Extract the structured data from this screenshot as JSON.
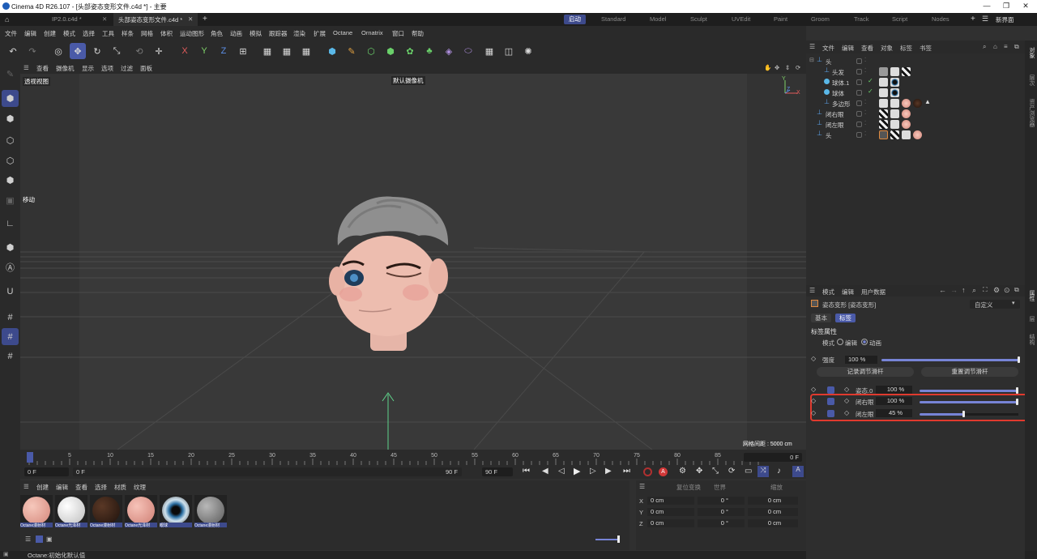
{
  "window": {
    "title": "Cinema 4D R26.107 - [头部姿态变形文件.c4d *] - 主要"
  },
  "file_tabs": [
    "IP2.0.c4d *",
    "头部姿态变形文件.c4d *"
  ],
  "layout_tabs": [
    "启动",
    "Standard",
    "Model",
    "Sculpt",
    "UVEdit",
    "Paint",
    "Groom",
    "Track",
    "Script",
    "Nodes"
  ],
  "new_layout": "新界面",
  "menu": [
    "文件",
    "编辑",
    "创建",
    "模式",
    "选择",
    "工具",
    "样条",
    "网格",
    "体积",
    "运动图形",
    "角色",
    "动画",
    "模拟",
    "跟踪器",
    "渲染",
    "扩展",
    "Octane",
    "Ornatrix",
    "窗口",
    "帮助"
  ],
  "toolbar_axes": [
    "X",
    "Y",
    "Z"
  ],
  "viewport": {
    "menu": [
      "查看",
      "摄像机",
      "显示",
      "选项",
      "过滤",
      "面板"
    ],
    "view_label": "透视视图",
    "camera_label": "默认摄像机",
    "move_label": "移动",
    "grid_spacing": "网格间距 : 5000 cm",
    "axis_y": "Y",
    "axis_x": "X",
    "axis_z": "Z"
  },
  "timeline": {
    "ticks": [
      "0",
      "5",
      "10",
      "15",
      "20",
      "25",
      "30",
      "35",
      "40",
      "45",
      "50",
      "55",
      "60",
      "65",
      "70",
      "75",
      "80",
      "85",
      "90"
    ],
    "current_frame": "0 F",
    "start_field": "0 F",
    "range_start": "0 F",
    "range_end": "90 F",
    "end_field": "90 F",
    "right_field": "0 F"
  },
  "material_manager": {
    "menu": [
      "创建",
      "编辑",
      "查看",
      "选择",
      "材质",
      "纹理"
    ],
    "materials": [
      {
        "label": "Octane漫射材",
        "color": "#e8a89c"
      },
      {
        "label": "Octane光泽材",
        "color": "#f0f0f0"
      },
      {
        "label": "Octane漫射材",
        "color": "#3a2418"
      },
      {
        "label": "Octane光泽材",
        "color": "#e9a29a"
      },
      {
        "label": "眼球",
        "color": "#1d5e8a"
      },
      {
        "label": "Octane漫射材",
        "color": "#8a8a8a"
      }
    ]
  },
  "coordinates": {
    "header": [
      "复位变换",
      "世界",
      "缩放"
    ],
    "rows": [
      {
        "axis": "X",
        "p": "0 cm",
        "r": "0 °",
        "s": "0 cm"
      },
      {
        "axis": "Y",
        "p": "0 cm",
        "r": "0 °",
        "s": "0 cm"
      },
      {
        "axis": "Z",
        "p": "0 cm",
        "r": "0 °",
        "s": "0 cm"
      }
    ]
  },
  "status": "Octane:初始化默认值",
  "object_manager": {
    "menu": [
      "文件",
      "编辑",
      "查看",
      "对象",
      "标签",
      "书签"
    ],
    "objects": [
      {
        "name": "头"
      },
      {
        "name": "头发"
      },
      {
        "name": "球体.1"
      },
      {
        "name": "球体"
      },
      {
        "name": "多边形"
      },
      {
        "name": "闭右眼"
      },
      {
        "name": "闭左眼"
      },
      {
        "name": "头"
      }
    ]
  },
  "attribute_manager": {
    "menu": [
      "模式",
      "编辑",
      "用户数据"
    ],
    "object_title": "姿态变形 [姿态变形]",
    "preset": "自定义",
    "tabs": [
      "基本",
      "标签"
    ],
    "section": "标签属性",
    "mode_label": "模式",
    "mode_options": [
      "编辑",
      "动画"
    ],
    "strength_label": "强度",
    "strength_value": "100 %",
    "strength_fraction": 1.0,
    "record_button": "记录调节滑杆",
    "reset_button": "重置调节滑杆",
    "poses": [
      {
        "name": "姿态.0",
        "value": "100 %",
        "fraction": 1.0
      },
      {
        "name": "闭右眼",
        "value": "100 %",
        "fraction": 1.0
      },
      {
        "name": "闭左眼",
        "value": "45 %",
        "fraction": 0.45
      }
    ],
    "highlight_color": "#e03a2e"
  },
  "right_strip": [
    "对象",
    "层次",
    "资产浏览器",
    "属性",
    "层",
    "结构"
  ],
  "colors": {
    "accent": "#3d4a8c",
    "slider": "#7784d6"
  }
}
